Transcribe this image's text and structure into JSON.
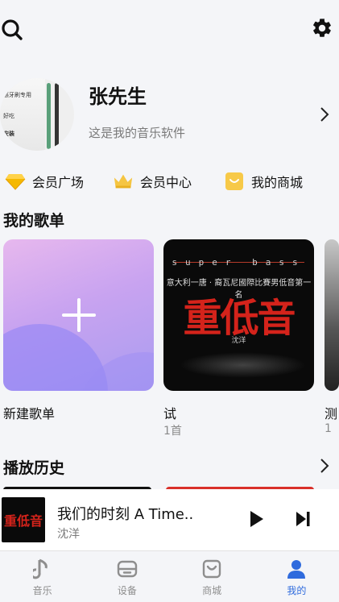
{
  "top_bar": {
    "search_icon": "search-icon",
    "settings_icon": "gear-icon"
  },
  "profile": {
    "name": "张先生",
    "bio": "这是我的音乐软件",
    "avatar_text": [
      "感牙刷专用",
      "好吃",
      "安装"
    ]
  },
  "quick_links": [
    {
      "label": "会员广场",
      "icon": "diamond-icon",
      "color": "#f5b800"
    },
    {
      "label": "会员中心",
      "icon": "crown-icon",
      "color": "#f5c542"
    },
    {
      "label": "我的商城",
      "icon": "bag-icon",
      "color": "#f7c948"
    }
  ],
  "my_playlists": {
    "title": "我的歌单",
    "items": [
      {
        "name": "新建歌单",
        "count": ""
      },
      {
        "name": "试",
        "count": "1首"
      },
      {
        "name": "测",
        "count": "1"
      }
    ],
    "album_cover": {
      "top_text": "super bass",
      "subtitle": "意大利一唐 · 裔瓦尼國際比賽男低音第一名",
      "title": "重低音",
      "artist": "沈洋"
    }
  },
  "history": {
    "title": "播放历史"
  },
  "mini_player": {
    "title": "我们的时刻 A Time..",
    "artist": "沈洋",
    "cover_text": "重低音"
  },
  "bottom_nav": [
    {
      "label": "音乐",
      "icon": "music-note-icon",
      "active": false
    },
    {
      "label": "设备",
      "icon": "device-icon",
      "active": false
    },
    {
      "label": "商城",
      "icon": "bag-icon",
      "active": false
    },
    {
      "label": "我的",
      "icon": "person-icon",
      "active": true
    }
  ],
  "colors": {
    "accent": "#2f6bdd",
    "background": "#f4f5f8",
    "album_red": "#d4231b"
  }
}
